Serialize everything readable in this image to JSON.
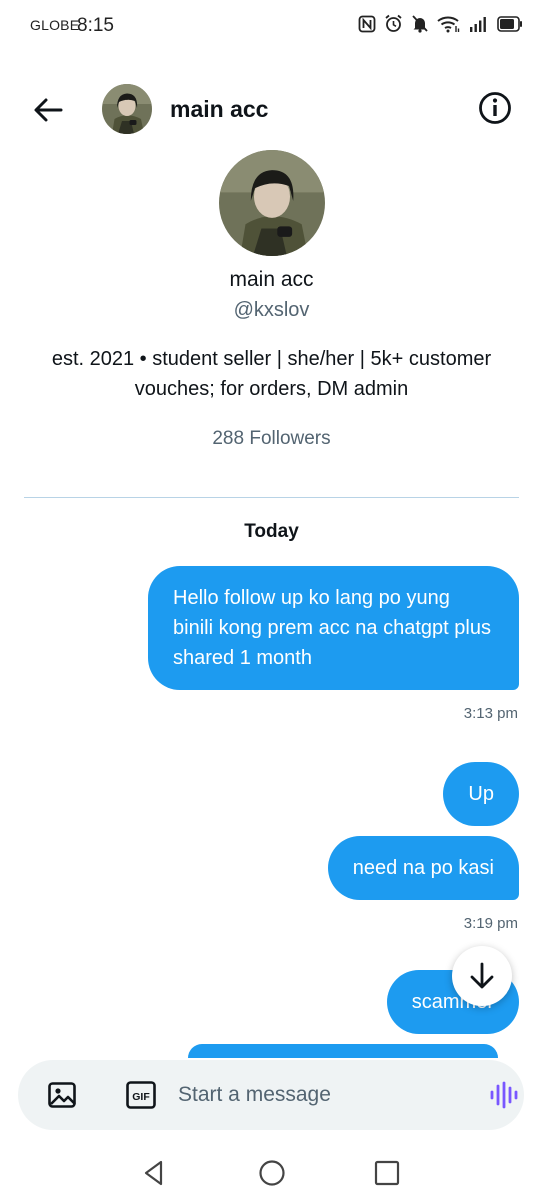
{
  "status_bar": {
    "carrier": "GLOBE",
    "time": "8:15",
    "icons": [
      "nfc-icon",
      "alarm-icon",
      "bell-muted-icon",
      "wifi-icon",
      "signal-icon",
      "battery-icon"
    ]
  },
  "header": {
    "title": "main acc",
    "back_icon": "arrow-left-icon",
    "info_icon": "info-circle-icon"
  },
  "profile": {
    "name": "main acc",
    "handle": "@kxslov",
    "bio": "est. 2021 • student seller | she/her | 5k+ customer vouches; for orders, DM admin",
    "followers": "288 Followers"
  },
  "conversation": {
    "day_label": "Today",
    "messages": [
      {
        "text": "Hello follow up ko lang po yung binili kong prem acc na chatgpt plus shared 1 month",
        "timestamp": "3:13 pm"
      },
      {
        "text": "Up"
      },
      {
        "text": "need na po kasi",
        "timestamp": "3:19 pm"
      },
      {
        "text": "scammer"
      }
    ]
  },
  "composer": {
    "placeholder": "Start a message",
    "gif_label": "GIF"
  },
  "nav_bar": {
    "buttons": [
      "back-triangle-icon",
      "home-circle-icon",
      "recents-square-icon"
    ]
  },
  "colors": {
    "accent": "#1d9bf0",
    "secondary_text": "#536471",
    "composer_bg": "#eff3f4",
    "voice_icon": "#7856ff"
  }
}
